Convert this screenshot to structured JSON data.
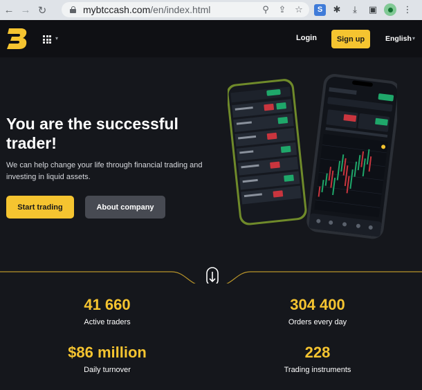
{
  "browser": {
    "back_icon": "←",
    "forward_icon": "→",
    "reload_icon": "↻",
    "url_host": "mybtccash.com",
    "url_path": "/en/index.html",
    "zoom_icon": "⚲",
    "share_icon": "⇪",
    "star_icon": "☆",
    "ext_s_label": "S",
    "puzzle_icon": "✱",
    "download_icon": "⤓",
    "sidepanel_icon": "▣",
    "menu_icon": "⋮"
  },
  "header": {
    "login_label": "Login",
    "signup_label": "Sign up",
    "language_label": "English",
    "caret": "▾",
    "brand_color": "#f5c430"
  },
  "hero": {
    "title": "You are the successful trader!",
    "subtitle": "We can help change your life through financial trading and investing in liquid assets.",
    "start_label": "Start trading",
    "about_label": "About company"
  },
  "stats": [
    {
      "value": "41 660",
      "label": "Active traders"
    },
    {
      "value": "304 400",
      "label": "Orders every day"
    },
    {
      "value": "$86 million",
      "label": "Daily turnover"
    },
    {
      "value": "228",
      "label": "Trading instruments"
    }
  ]
}
